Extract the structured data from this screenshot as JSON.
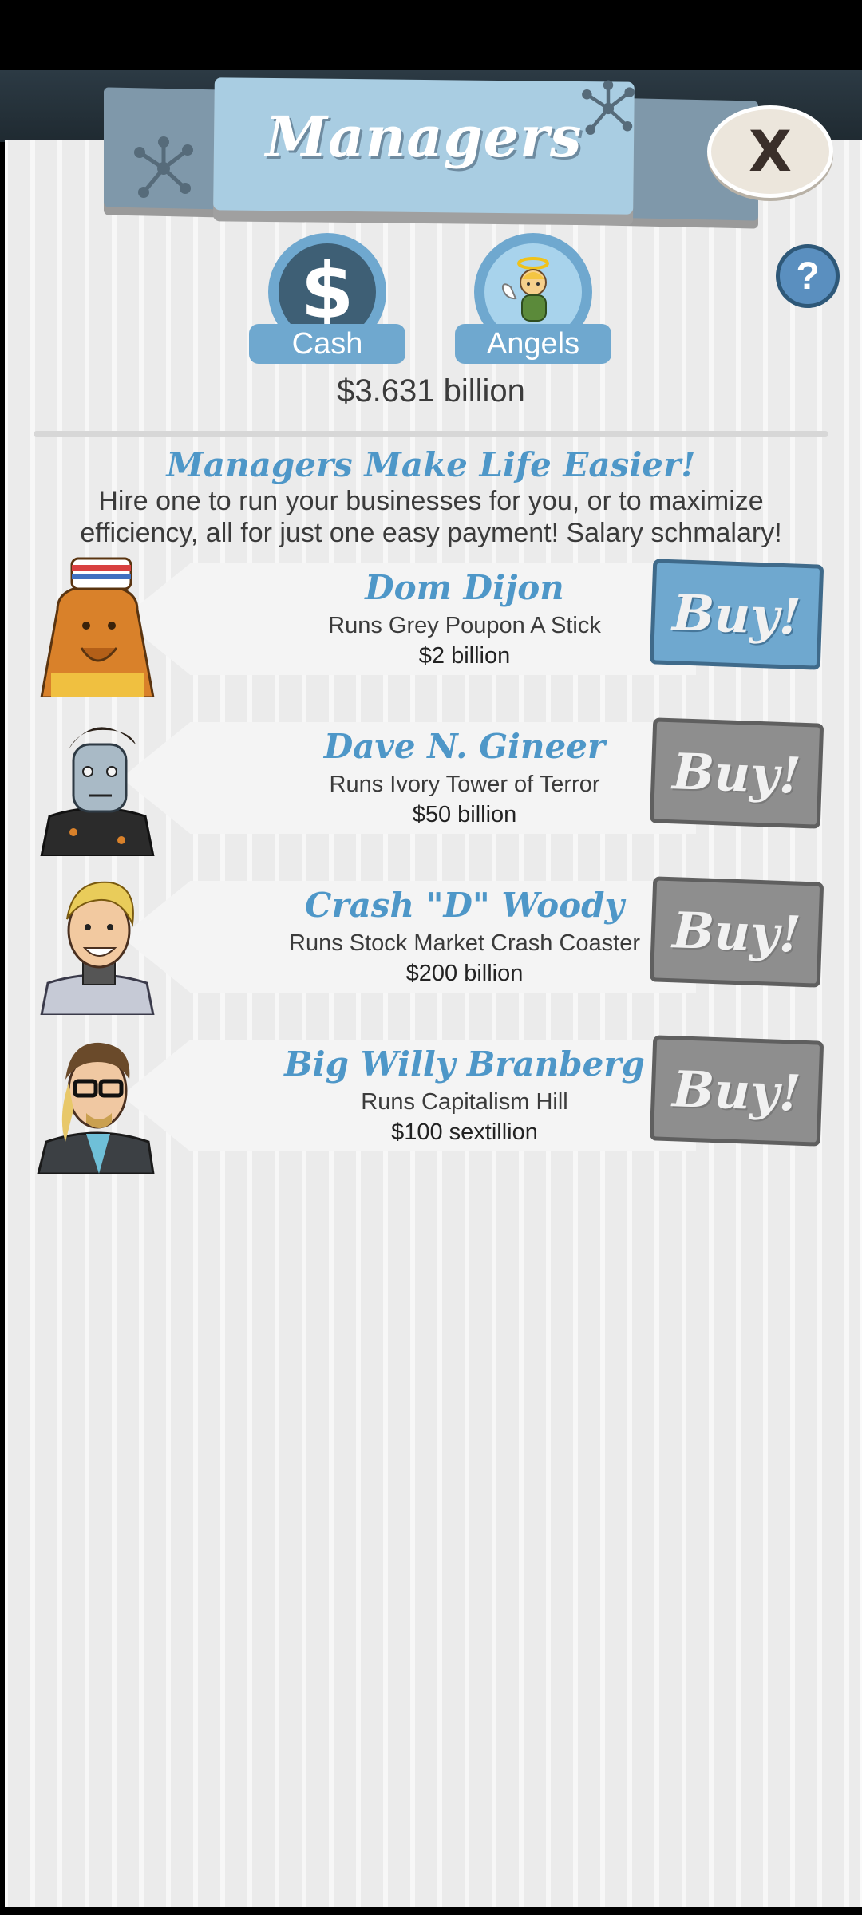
{
  "header": {
    "title": "Managers",
    "close_label": "X",
    "help_label": "?"
  },
  "currency_tabs": [
    {
      "label": "Cash",
      "icon": "dollar-icon",
      "selected": true
    },
    {
      "label": "Angels",
      "icon": "angel-icon",
      "selected": false
    }
  ],
  "balance": "$3.631 billion",
  "promo": {
    "title": "Managers Make Life Easier!",
    "text": "Hire one to run your businesses for you, or to maximize efficiency, all for just one easy payment! Salary schmalary!"
  },
  "managers": [
    {
      "name": "Dom Dijon",
      "desc": "Runs Grey Poupon A Stick",
      "price": "$2 billion",
      "buy_label": "Buy!",
      "affordable": true
    },
    {
      "name": "Dave N. Gineer",
      "desc": "Runs Ivory Tower of Terror",
      "price": "$50 billion",
      "buy_label": "Buy!",
      "affordable": false
    },
    {
      "name": "Crash \"D\" Woody",
      "desc": "Runs Stock Market Crash Coaster",
      "price": "$200 billion",
      "buy_label": "Buy!",
      "affordable": false
    },
    {
      "name": "Big Willy Branberg",
      "desc": "Runs Capitalism Hill",
      "price": "$100 sextillion",
      "buy_label": "Buy!",
      "affordable": false
    }
  ],
  "colors": {
    "accent_blue": "#6fa8cf",
    "title_blue": "#4e97c8",
    "disabled_gray": "#8e8e8e"
  }
}
